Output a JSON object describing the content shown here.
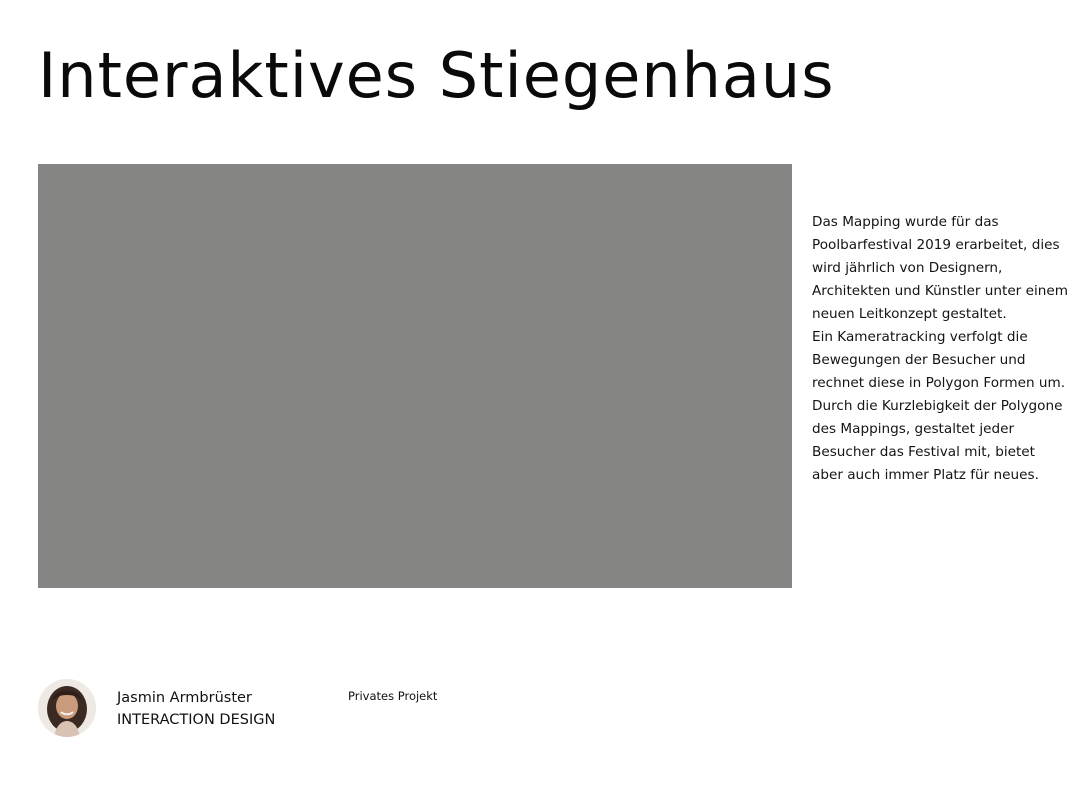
{
  "project": {
    "title": "Interaktives Stiegenhaus",
    "media": {
      "background_color": "#858584"
    },
    "description": "Das Mapping wurde für das\nPoolbarfestival 2019 erarbeitet, dies\nwird jährlich von Designern,\nArchitekten und Künstler unter einem\nneuen Leitkonzept gestaltet.\nEin Kameratracking verfolgt die\nBewegungen der Besucher und\nrechnet diese in Polygon Formen um.\nDurch die Kurzlebigkeit der Polygone\ndes Mappings, gestaltet jeder\nBesucher das Festival mit, bietet\naber auch immer Platz für neues."
  },
  "author": {
    "name": "Jasmin Armbrüster",
    "role": "INTERACTION DESIGN",
    "avatar_icon": "person-photo-avatar"
  },
  "meta": {
    "project_type": "Privates Projekt"
  }
}
